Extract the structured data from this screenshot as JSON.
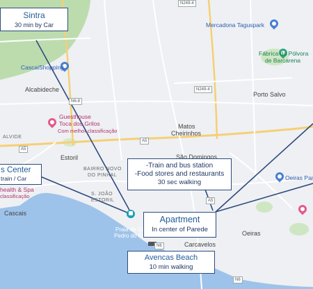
{
  "callouts": {
    "sintra": {
      "title": "Sintra",
      "detail": "30 min by  Car"
    },
    "center": {
      "title": "s Center",
      "detail": "train / Car"
    },
    "transport": {
      "line1": "-Train and bus station",
      "line2": "-Food stores and restaurants",
      "detail": "30 sec walking"
    },
    "apartment": {
      "title": "Apartment",
      "detail": "In center of Parede"
    },
    "beach": {
      "title": "Avencas Beach",
      "detail": "10 min walking"
    }
  },
  "places": {
    "mercadona": "Mercadona Taguspark",
    "cascaishopping": "CascaiShopping",
    "alcabideche": "Alcabideche",
    "guesthouse_1": "Guesthouse",
    "guesthouse_2": "Toca dos Grilos",
    "guesthouse_3": "Com melhor classificação",
    "fabrica_1": "Fábrica da Pólvora",
    "fabrica_2": "de Barcarena",
    "porto_salvo": "Porto Salvo",
    "matos_1": "Matos",
    "matos_2": "Cheirinhos",
    "sao_domingos": "São Domingos",
    "alvide": "ALVIDE",
    "estoril": "Estoril",
    "bairro": "BAIRRO NOVO",
    "do_pinhal": "DO PINHAL",
    "sao_joao": "S. JOÃO",
    "estoril2": "ESTORIL",
    "health_spa": "health & Spa",
    "classificacao": "classificação",
    "cascais": "Cascais",
    "oeiras_parque": "Oeiras Parque",
    "oeiras": "Oeiras",
    "carcavelos": "Carcavelos",
    "praia_1": "Praia de São",
    "praia_2": "Pedro do Estoril"
  },
  "roads": {
    "n249": "N249-4",
    "n249b": "N249-4",
    "n6": "N6-8",
    "a5a": "A5",
    "a5b": "A5",
    "a5c": "A5",
    "n6b": "N6",
    "n6c": "N6"
  },
  "colors": {
    "sea": "#9ec3ea",
    "land": "#eef0f3",
    "park": "#bcdcae",
    "road": "#ffffff",
    "highway": "#f6cf75",
    "line": "#2e4a7d"
  }
}
